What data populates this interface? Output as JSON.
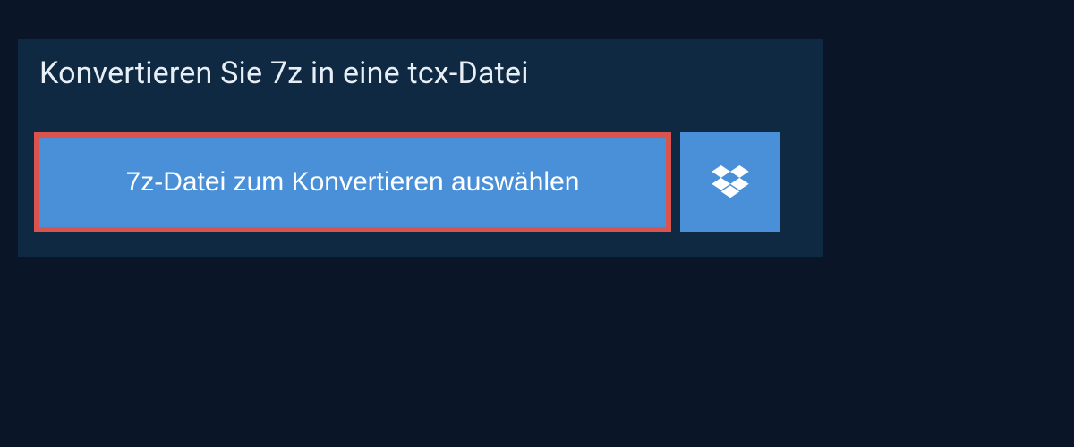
{
  "header": {
    "title": "Konvertieren Sie 7z in eine tcx-Datei"
  },
  "actions": {
    "select_file_label": "7z-Datei zum Konvertieren auswählen",
    "dropbox_icon": "dropbox-icon"
  },
  "colors": {
    "background": "#0a1628",
    "panel": "#0f2942",
    "button": "#4a90d9",
    "highlight": "#d9534f",
    "text_light": "#e8eef5"
  }
}
